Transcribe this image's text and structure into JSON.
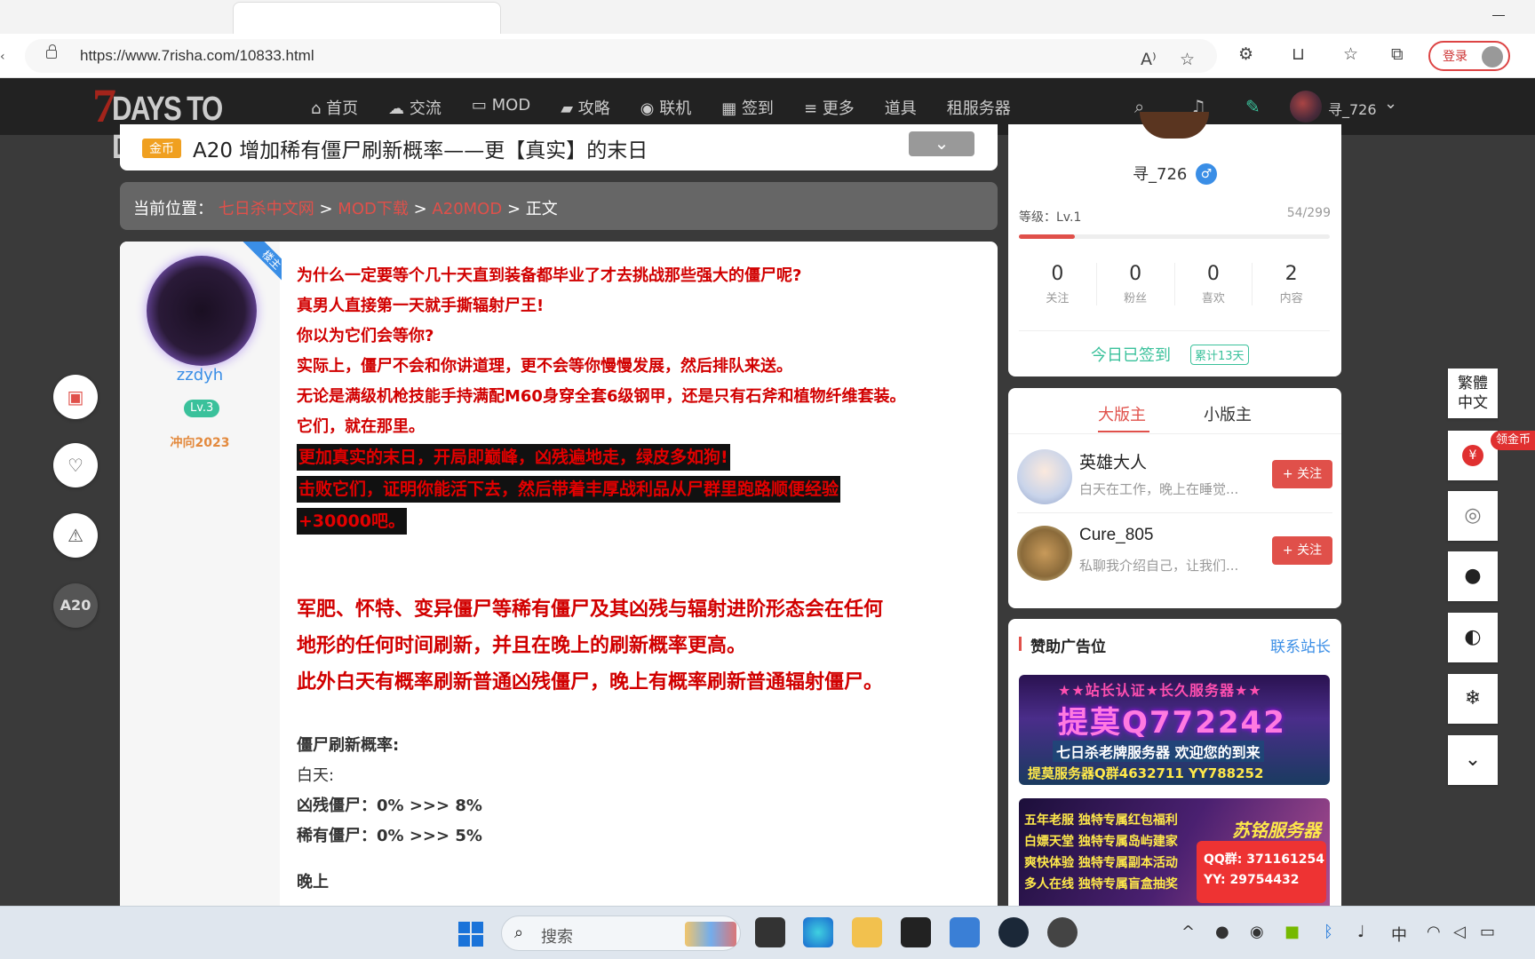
{
  "browser": {
    "url": "https://www.7risha.com/10833.html",
    "login_label": "登录"
  },
  "site": {
    "logo_seven": "7",
    "logo_text": "DAYS TO DIE",
    "nav": [
      {
        "label": "首页",
        "icon": "home-icon"
      },
      {
        "label": "交流",
        "icon": "chat-icon"
      },
      {
        "label": "MOD",
        "icon": "folder-icon"
      },
      {
        "label": "攻略",
        "icon": "book-icon"
      },
      {
        "label": "联机",
        "icon": "compass-icon"
      },
      {
        "label": "签到",
        "icon": "calendar-icon"
      },
      {
        "label": "更多",
        "icon": "menu-icon"
      },
      {
        "label": "道具",
        "icon": ""
      },
      {
        "label": "租服务器",
        "icon": ""
      }
    ],
    "username": "寻_726"
  },
  "post_header": {
    "badge": "金币",
    "title": "A20 增加稀有僵尸刷新概率——更【真实】的末日"
  },
  "breadcrumb": {
    "prefix": "当前位置：",
    "items": [
      "七日杀中文网",
      "MOD下载",
      "A20MOD"
    ],
    "current": "正文",
    "sep": ">"
  },
  "author": {
    "ribbon": "楼主",
    "name": "zzdyh",
    "level": "Lv.3",
    "motto": "冲向2023"
  },
  "content": {
    "red_lines": [
      "为什么一定要等个几十天直到装备都毕业了才去挑战那些强大的僵尸呢?",
      "真男人直接第一天就手撕辐射尸王!",
      "你以为它们会等你?",
      "实际上，僵尸不会和你讲道理，更不会等你慢慢发展，然后排队来送。",
      "无论是满级机枪技能手持满配M60身穿全套6级钢甲，还是只有石斧和植物纤维套装。",
      "它们，就在那里。"
    ],
    "highlight_lines": [
      "更加真实的末日，开局即巅峰，凶残遍地走，绿皮多如狗!",
      "击败它们，证明你能活下去，然后带着丰厚战利品从尸群里跑路顺便经验",
      "+30000吧。"
    ],
    "big_lines": [
      "军肥、怀特、变异僵尸等稀有僵尸及其凶残与辐射进阶形态会在任何",
      "地形的任何时间刷新，并且在晚上的刷新概率更高。",
      "此外白天有概率刷新普通凶残僵尸，晚上有概率刷新普通辐射僵尸。"
    ],
    "rate_title": "僵尸刷新概率:",
    "daytime": "白天:",
    "rate1": "凶残僵尸：0% >>> 8%",
    "rate2": "稀有僵尸：0% >>> 5%",
    "cut_line": "晚上"
  },
  "side_left": {
    "a20_label": "A20"
  },
  "profile": {
    "name": "寻_726",
    "gender": "♂",
    "level_label": "等级：Lv.1",
    "level_progress": "54/299",
    "level_fraction": 0.18,
    "stats": [
      {
        "n": "0",
        "l": "关注"
      },
      {
        "n": "0",
        "l": "粉丝"
      },
      {
        "n": "0",
        "l": "喜欢"
      },
      {
        "n": "2",
        "l": "内容"
      }
    ],
    "signed": "今日已签到",
    "signed_count": "累计13天"
  },
  "moderators": {
    "tab_major": "大版主",
    "tab_minor": "小版主",
    "follow_label": "+ 关注",
    "items": [
      {
        "name": "英雄大人",
        "desc": "白天在工作，晚上在睡觉..."
      },
      {
        "name": "Cure_805",
        "desc": "私聊我介绍自己，让我们..."
      }
    ]
  },
  "ads": {
    "heading": "赞助广告位",
    "contact": "联系站长",
    "ad1": {
      "line1": "★★站长认证★长久服务器★★",
      "line2": "提莫Q772242",
      "line3": "七日杀老牌服务器 欢迎您的到来",
      "line4": "提莫服务器Q群4632711 YY788252"
    },
    "ad2": {
      "rows": [
        "五年老服  独特专属红包福利",
        "白嫖天堂  独特专属岛屿建家",
        "爽快体验  独特专属副本活动",
        "多人在线  独特专属盲盒抽奖"
      ],
      "brand": "苏铭服务器",
      "qq": "QQ群: 371161254",
      "yy": "YY: 29754432"
    }
  },
  "right_toolbar": {
    "lang": "繁體\n中文",
    "lang_line1": "繁體",
    "lang_line2": "中文",
    "coin_tag": "领金币"
  },
  "taskbar": {
    "search_placeholder": "搜索",
    "ime": "中"
  }
}
